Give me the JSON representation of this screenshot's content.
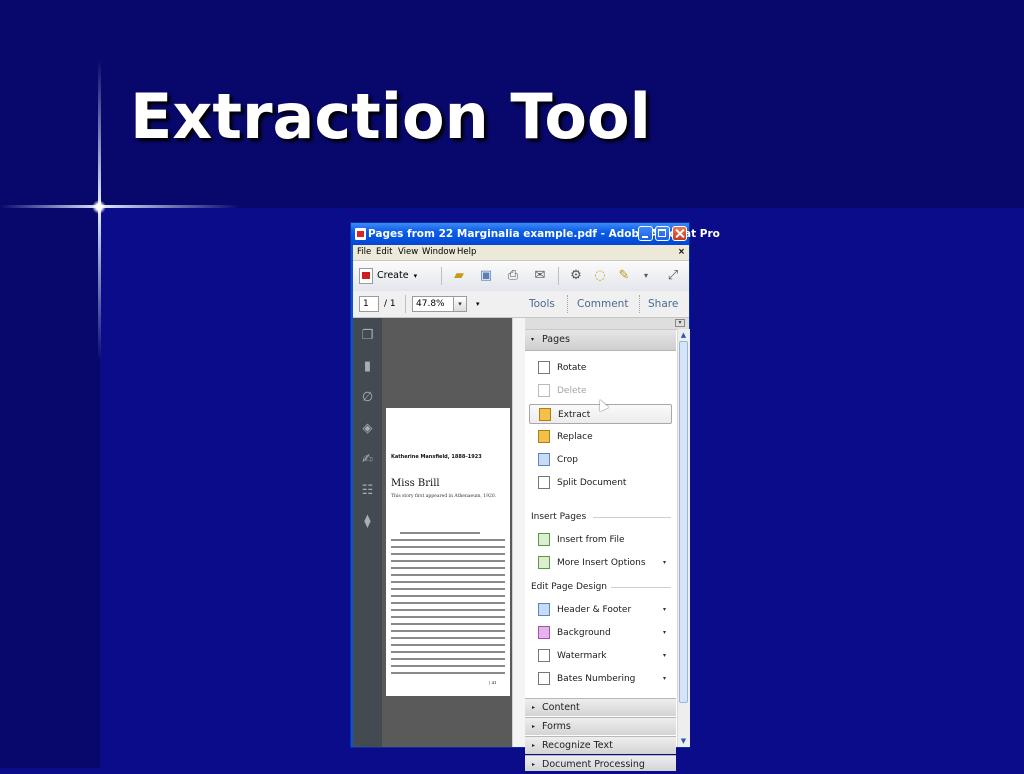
{
  "slide": {
    "title": "Extraction Tool"
  },
  "window": {
    "title": "Pages from 22 Marginalia example.pdf - Adobe Acrobat Pro",
    "menu": [
      "File",
      "Edit",
      "View",
      "Window",
      "Help"
    ],
    "menu_close": "×",
    "toolbar": {
      "create_label": "Create",
      "create_caret": "▾",
      "icons": [
        "open-folder-icon",
        "save-icon",
        "print-icon",
        "email-icon",
        "settings-gear-icon",
        "comment-bubble-icon",
        "sign-pen-icon",
        "more-caret-icon",
        "fullscreen-icon"
      ]
    },
    "navbar": {
      "page_current": "1",
      "page_total": "/ 1",
      "zoom": "47.8%",
      "zoom_caret": "▾",
      "more_caret": "▾",
      "panes": [
        "Tools",
        "Comment",
        "Share"
      ]
    }
  },
  "document": {
    "author_line": "Katherine Mansfield, 1888–1923",
    "story_title": "Miss Brill",
    "subtitle": "This story first appeared in Athenaeum, 1920.",
    "folio": "| 41"
  },
  "tools_pane": {
    "pages_header": "Pages",
    "page_tools": [
      {
        "label": "Rotate",
        "enabled": true
      },
      {
        "label": "Delete",
        "enabled": false
      },
      {
        "label": "Extract",
        "enabled": true,
        "selected": true
      },
      {
        "label": "Replace",
        "enabled": true
      },
      {
        "label": "Crop",
        "enabled": true
      },
      {
        "label": "Split Document",
        "enabled": true
      }
    ],
    "insert_pages_header": "Insert Pages",
    "insert_tools": [
      {
        "label": "Insert from File"
      },
      {
        "label": "More Insert Options"
      }
    ],
    "edit_design_header": "Edit Page Design",
    "design_tools": [
      {
        "label": "Header & Footer"
      },
      {
        "label": "Background"
      },
      {
        "label": "Watermark"
      },
      {
        "label": "Bates Numbering"
      }
    ],
    "collapsed_sections": [
      "Content",
      "Forms",
      "Recognize Text",
      "Document Processing"
    ],
    "caret_open": "▾",
    "caret_closed": "▸",
    "dropdown_caret": "▾"
  },
  "colors": {
    "slide_background": "#0a0c8a",
    "titlebar_blue": "#0a5ee8",
    "acrobat_red": "#cc2020"
  }
}
